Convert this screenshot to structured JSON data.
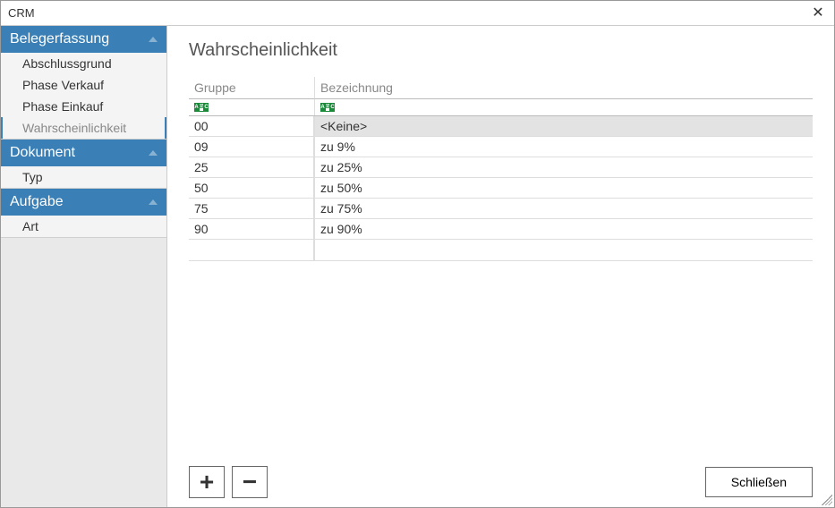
{
  "window": {
    "title": "CRM",
    "close_symbol": "✕"
  },
  "sidebar": {
    "sections": [
      {
        "label": "Belegerfassung",
        "items": [
          {
            "label": "Abschlussgrund",
            "active": false
          },
          {
            "label": "Phase Verkauf",
            "active": false
          },
          {
            "label": "Phase Einkauf",
            "active": false
          },
          {
            "label": "Wahrscheinlichkeit",
            "active": true
          }
        ]
      },
      {
        "label": "Dokument",
        "items": [
          {
            "label": "Typ",
            "active": false
          }
        ]
      },
      {
        "label": "Aufgabe",
        "items": [
          {
            "label": "Art",
            "active": false
          }
        ]
      }
    ]
  },
  "content": {
    "title": "Wahrscheinlichkeit",
    "columns": {
      "col1": "Gruppe",
      "col2": "Bezeichnung"
    },
    "rows": [
      {
        "gruppe": "00",
        "bezeichnung": "<Keine>",
        "selected": true
      },
      {
        "gruppe": "09",
        "bezeichnung": "zu 9%",
        "selected": false
      },
      {
        "gruppe": "25",
        "bezeichnung": "zu 25%",
        "selected": false
      },
      {
        "gruppe": "50",
        "bezeichnung": "zu 50%",
        "selected": false
      },
      {
        "gruppe": "75",
        "bezeichnung": "zu 75%",
        "selected": false
      },
      {
        "gruppe": "90",
        "bezeichnung": "zu 90%",
        "selected": false
      }
    ]
  },
  "footer": {
    "add_symbol": "+",
    "remove_symbol": "−",
    "close_label": "Schließen"
  }
}
